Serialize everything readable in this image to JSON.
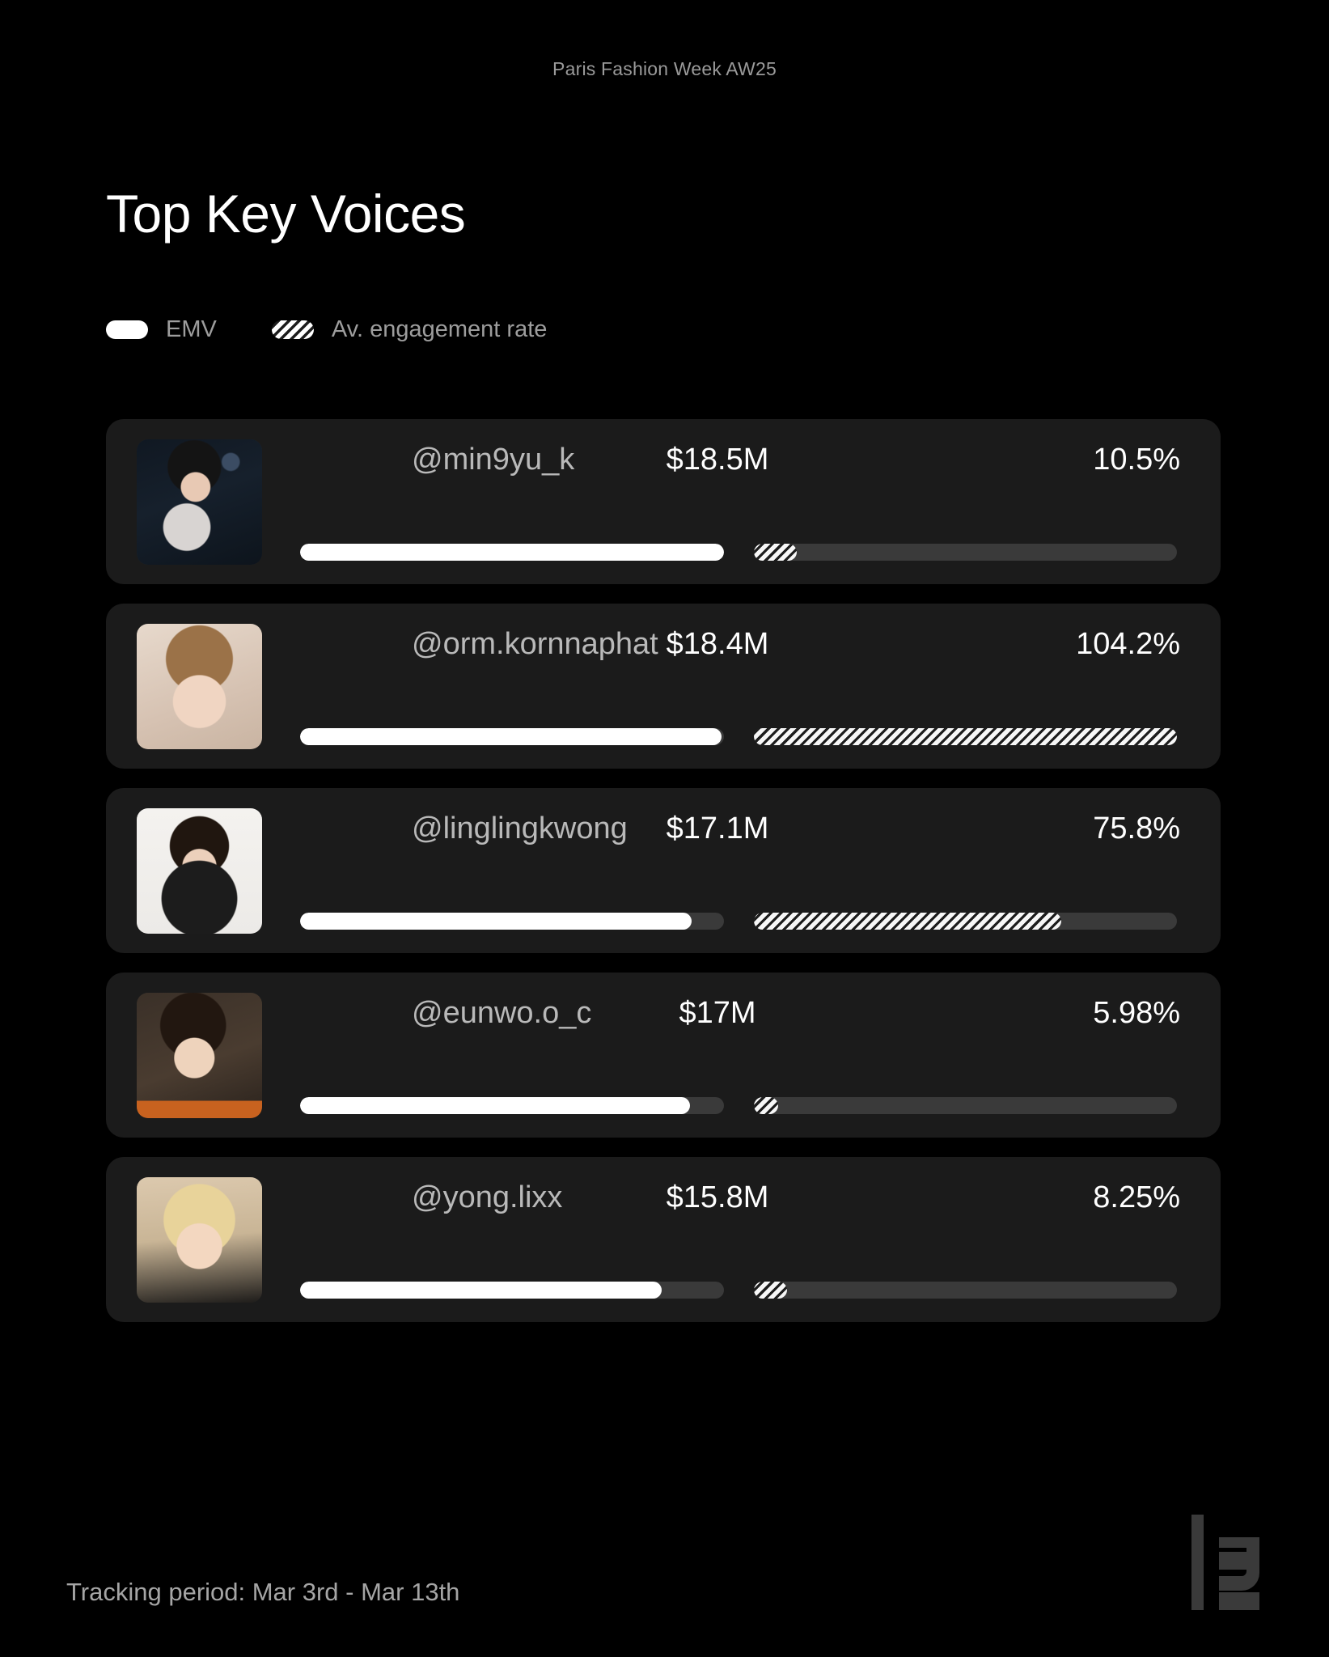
{
  "header": {
    "eyebrow": "Paris Fashion Week AW25",
    "title": "Top Key Voices"
  },
  "legend": {
    "items": [
      {
        "label": "EMV",
        "swatch": "solid-pill-icon",
        "color": "#ffffff"
      },
      {
        "label": "Av. engagement rate",
        "swatch": "hatched-pill-icon",
        "color": "#ffffff"
      }
    ]
  },
  "chart_data": {
    "type": "bar",
    "title": "Top Key Voices",
    "subtitle": "Paris Fashion Week AW25",
    "categories": [
      "@min9yu_k",
      "@orm.kornnaphat",
      "@linglingkwong",
      "@eunwo.o_c",
      "@yong.lixx"
    ],
    "series": [
      {
        "name": "EMV",
        "unit": "USD millions",
        "labels": [
          "$18.5M",
          "$18.4M",
          "$17.1M",
          "$17M",
          "$15.8M"
        ],
        "values": [
          18.5,
          18.4,
          17.1,
          17.0,
          15.8
        ],
        "max": 18.5,
        "fill_pct": [
          100,
          99.5,
          92.4,
          91.9,
          85.4
        ],
        "style": "solid"
      },
      {
        "name": "Av. engagement rate",
        "unit": "%",
        "labels": [
          "10.5%",
          "104.2%",
          "75.8%",
          "5.98%",
          "8.25%"
        ],
        "values": [
          10.5,
          104.2,
          75.8,
          5.98,
          8.25
        ],
        "max": 104.2,
        "fill_pct": [
          10.1,
          100,
          72.7,
          5.7,
          7.9
        ],
        "style": "hatched"
      }
    ],
    "xlabel": "",
    "ylabel": "",
    "grid": false,
    "legend_position": "top-left"
  },
  "rows": [
    {
      "rank": 1,
      "handle": "@min9yu_k",
      "emv": "$18.5M",
      "emv_pct": 100,
      "engagement": "10.5%",
      "engagement_pct": 10.1,
      "avatar": "avatar-min9yu-k"
    },
    {
      "rank": 2,
      "handle": "@orm.kornnaphat",
      "emv": "$18.4M",
      "emv_pct": 99.5,
      "engagement": "104.2%",
      "engagement_pct": 100,
      "avatar": "avatar-orm-kornnaphat"
    },
    {
      "rank": 3,
      "handle": "@linglingkwong",
      "emv": "$17.1M",
      "emv_pct": 92.4,
      "engagement": "75.8%",
      "engagement_pct": 72.7,
      "avatar": "avatar-linglingkwong"
    },
    {
      "rank": 4,
      "handle": "@eunwo.o_c",
      "emv": "$17M",
      "emv_pct": 91.9,
      "engagement": "5.98%",
      "engagement_pct": 5.7,
      "avatar": "avatar-eunwo-o-c"
    },
    {
      "rank": 5,
      "handle": "@yong.lixx",
      "emv": "$15.8M",
      "emv_pct": 85.4,
      "engagement": "8.25%",
      "engagement_pct": 7.9,
      "avatar": "avatar-yong-lixx"
    }
  ],
  "footer": {
    "tracking_period": "Tracking period: Mar 3rd - Mar 13th",
    "logo": "lefty-logo-icon"
  },
  "colors": {
    "background": "#000000",
    "card": "#1b1b1b",
    "track": "#3a3a3a",
    "bar": "#ffffff",
    "muted_text": "#9d9d9d",
    "primary_text": "#ffffff"
  }
}
